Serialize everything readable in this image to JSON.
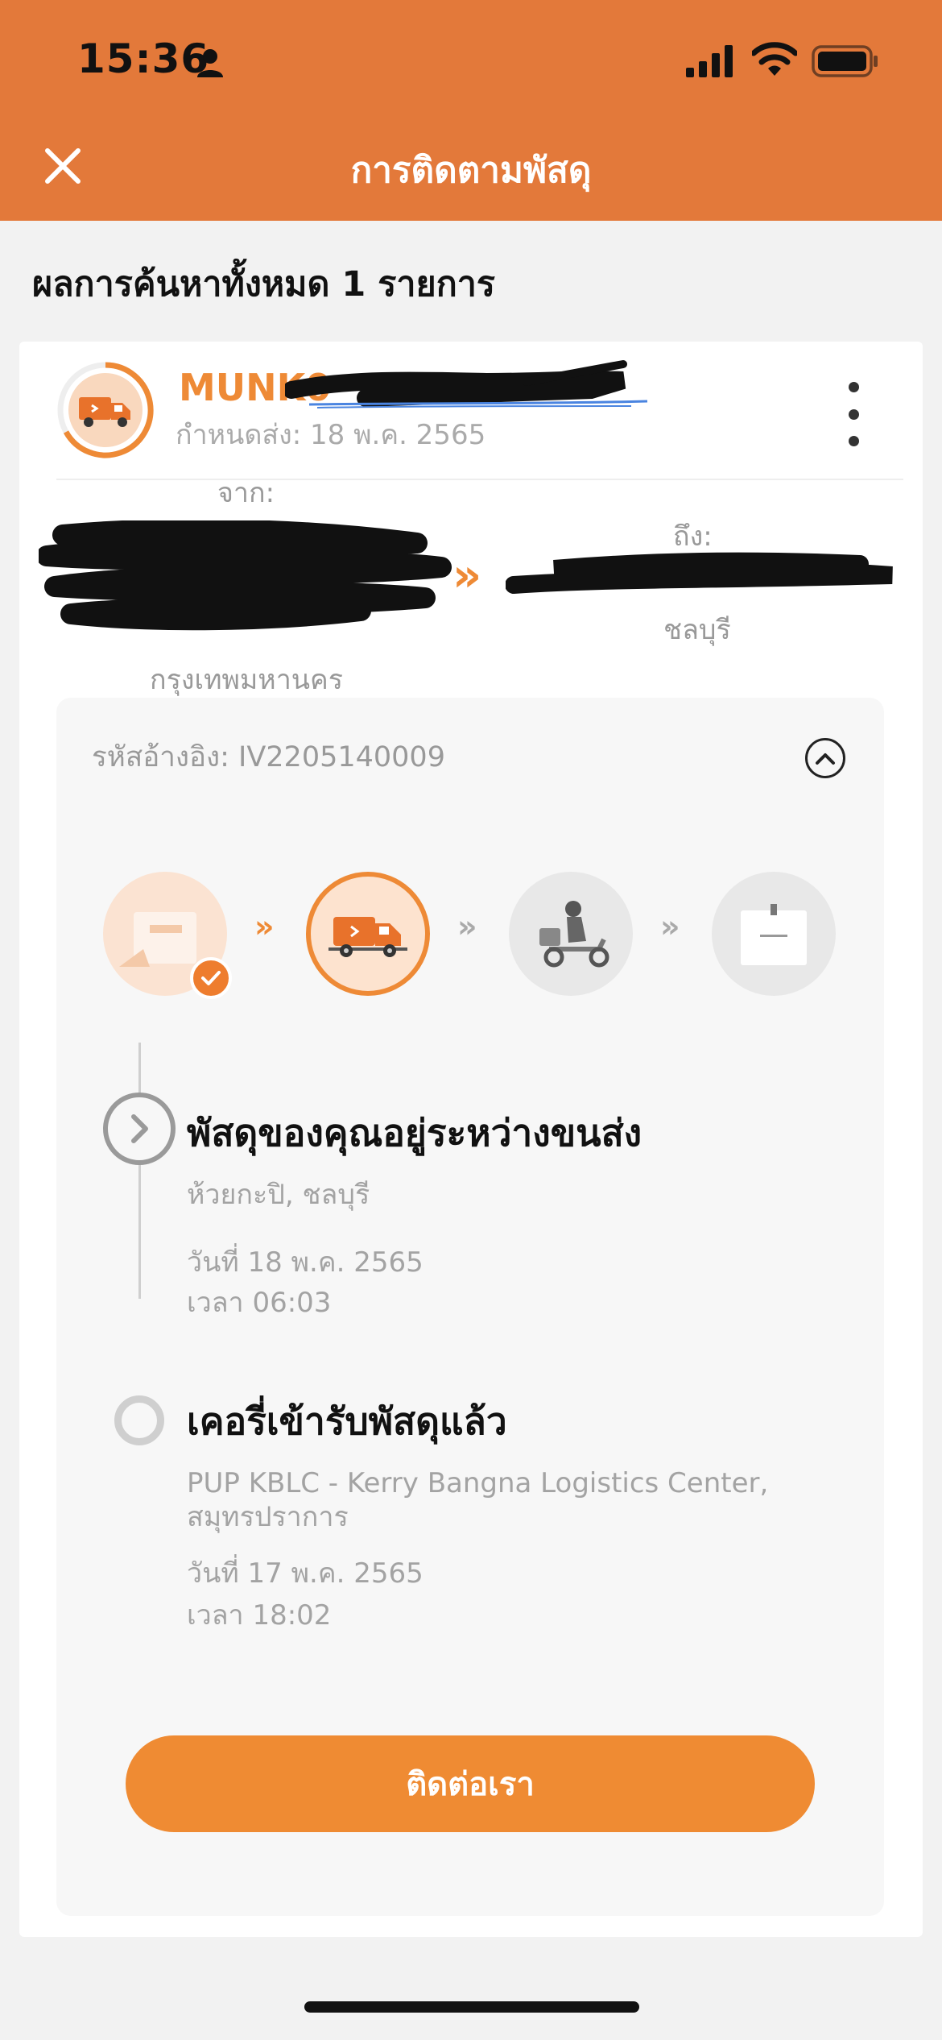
{
  "status_bar": {
    "time": "15:36"
  },
  "header": {
    "title": "การติดตามพัสดุ"
  },
  "results": {
    "summary": "ผลการค้นหาทั้งหมด 1 รายการ"
  },
  "shipment": {
    "tracking_prefix": "MUNK0",
    "due_date": "กำหนดส่ง: 18 พ.ค. 2565",
    "from_label": "จาก:",
    "from_city": "กรุงเทพมหานคร",
    "to_label": "ถึง:",
    "to_city": "ชลบุรี",
    "route_arrow": "»",
    "reference": "รหัสอ้างอิง: IV2205140009",
    "progress": {
      "steps_total": 4,
      "current_step": 2
    },
    "step_separator": "»"
  },
  "timeline": [
    {
      "title": "พัสดุของคุณอยู่ระหว่างขนส่ง",
      "location": "ห้วยกะปิ, ชลบุรี",
      "date": "วันที่ 18 พ.ค. 2565",
      "time": "เวลา 06:03"
    },
    {
      "title": "เคอรี่เข้ารับพัสดุแล้ว",
      "location_line1": "PUP KBLC - Kerry Bangna Logistics Center,",
      "location_line2": "สมุทรปราการ",
      "date": "วันที่ 17 พ.ค. 2565",
      "time": "เวลา 18:02"
    }
  ],
  "contact_button": {
    "label": "ติดต่อเรา"
  },
  "colors": {
    "brand": "#e3793a",
    "accent": "#ef8b33",
    "muted": "#a3a3a3"
  },
  "icons": [
    "person-icon",
    "signal-icon",
    "wifi-icon",
    "battery-icon",
    "close-icon",
    "truck-icon",
    "more-icon",
    "chevron-up-icon",
    "chevron-right-icon",
    "check-icon",
    "box-icon",
    "scooter-icon"
  ]
}
